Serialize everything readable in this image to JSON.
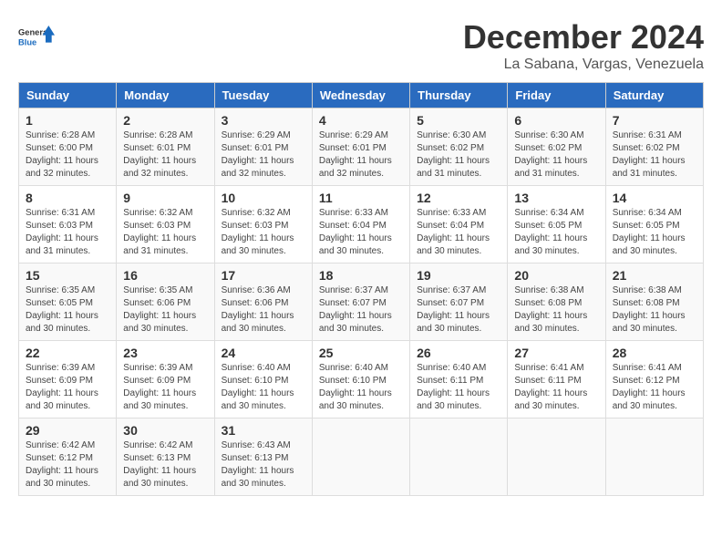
{
  "logo": {
    "general": "General",
    "blue": "Blue"
  },
  "title": "December 2024",
  "subtitle": "La Sabana, Vargas, Venezuela",
  "headers": [
    "Sunday",
    "Monday",
    "Tuesday",
    "Wednesday",
    "Thursday",
    "Friday",
    "Saturday"
  ],
  "weeks": [
    [
      {
        "day": "1",
        "sunrise": "6:28 AM",
        "sunset": "6:00 PM",
        "daylight": "11 hours and 32 minutes."
      },
      {
        "day": "2",
        "sunrise": "6:28 AM",
        "sunset": "6:01 PM",
        "daylight": "11 hours and 32 minutes."
      },
      {
        "day": "3",
        "sunrise": "6:29 AM",
        "sunset": "6:01 PM",
        "daylight": "11 hours and 32 minutes."
      },
      {
        "day": "4",
        "sunrise": "6:29 AM",
        "sunset": "6:01 PM",
        "daylight": "11 hours and 32 minutes."
      },
      {
        "day": "5",
        "sunrise": "6:30 AM",
        "sunset": "6:02 PM",
        "daylight": "11 hours and 31 minutes."
      },
      {
        "day": "6",
        "sunrise": "6:30 AM",
        "sunset": "6:02 PM",
        "daylight": "11 hours and 31 minutes."
      },
      {
        "day": "7",
        "sunrise": "6:31 AM",
        "sunset": "6:02 PM",
        "daylight": "11 hours and 31 minutes."
      }
    ],
    [
      {
        "day": "8",
        "sunrise": "6:31 AM",
        "sunset": "6:03 PM",
        "daylight": "11 hours and 31 minutes."
      },
      {
        "day": "9",
        "sunrise": "6:32 AM",
        "sunset": "6:03 PM",
        "daylight": "11 hours and 31 minutes."
      },
      {
        "day": "10",
        "sunrise": "6:32 AM",
        "sunset": "6:03 PM",
        "daylight": "11 hours and 30 minutes."
      },
      {
        "day": "11",
        "sunrise": "6:33 AM",
        "sunset": "6:04 PM",
        "daylight": "11 hours and 30 minutes."
      },
      {
        "day": "12",
        "sunrise": "6:33 AM",
        "sunset": "6:04 PM",
        "daylight": "11 hours and 30 minutes."
      },
      {
        "day": "13",
        "sunrise": "6:34 AM",
        "sunset": "6:05 PM",
        "daylight": "11 hours and 30 minutes."
      },
      {
        "day": "14",
        "sunrise": "6:34 AM",
        "sunset": "6:05 PM",
        "daylight": "11 hours and 30 minutes."
      }
    ],
    [
      {
        "day": "15",
        "sunrise": "6:35 AM",
        "sunset": "6:05 PM",
        "daylight": "11 hours and 30 minutes."
      },
      {
        "day": "16",
        "sunrise": "6:35 AM",
        "sunset": "6:06 PM",
        "daylight": "11 hours and 30 minutes."
      },
      {
        "day": "17",
        "sunrise": "6:36 AM",
        "sunset": "6:06 PM",
        "daylight": "11 hours and 30 minutes."
      },
      {
        "day": "18",
        "sunrise": "6:37 AM",
        "sunset": "6:07 PM",
        "daylight": "11 hours and 30 minutes."
      },
      {
        "day": "19",
        "sunrise": "6:37 AM",
        "sunset": "6:07 PM",
        "daylight": "11 hours and 30 minutes."
      },
      {
        "day": "20",
        "sunrise": "6:38 AM",
        "sunset": "6:08 PM",
        "daylight": "11 hours and 30 minutes."
      },
      {
        "day": "21",
        "sunrise": "6:38 AM",
        "sunset": "6:08 PM",
        "daylight": "11 hours and 30 minutes."
      }
    ],
    [
      {
        "day": "22",
        "sunrise": "6:39 AM",
        "sunset": "6:09 PM",
        "daylight": "11 hours and 30 minutes."
      },
      {
        "day": "23",
        "sunrise": "6:39 AM",
        "sunset": "6:09 PM",
        "daylight": "11 hours and 30 minutes."
      },
      {
        "day": "24",
        "sunrise": "6:40 AM",
        "sunset": "6:10 PM",
        "daylight": "11 hours and 30 minutes."
      },
      {
        "day": "25",
        "sunrise": "6:40 AM",
        "sunset": "6:10 PM",
        "daylight": "11 hours and 30 minutes."
      },
      {
        "day": "26",
        "sunrise": "6:40 AM",
        "sunset": "6:11 PM",
        "daylight": "11 hours and 30 minutes."
      },
      {
        "day": "27",
        "sunrise": "6:41 AM",
        "sunset": "6:11 PM",
        "daylight": "11 hours and 30 minutes."
      },
      {
        "day": "28",
        "sunrise": "6:41 AM",
        "sunset": "6:12 PM",
        "daylight": "11 hours and 30 minutes."
      }
    ],
    [
      {
        "day": "29",
        "sunrise": "6:42 AM",
        "sunset": "6:12 PM",
        "daylight": "11 hours and 30 minutes."
      },
      {
        "day": "30",
        "sunrise": "6:42 AM",
        "sunset": "6:13 PM",
        "daylight": "11 hours and 30 minutes."
      },
      {
        "day": "31",
        "sunrise": "6:43 AM",
        "sunset": "6:13 PM",
        "daylight": "11 hours and 30 minutes."
      },
      null,
      null,
      null,
      null
    ]
  ],
  "labels": {
    "sunrise": "Sunrise:",
    "sunset": "Sunset:",
    "daylight": "Daylight:"
  }
}
